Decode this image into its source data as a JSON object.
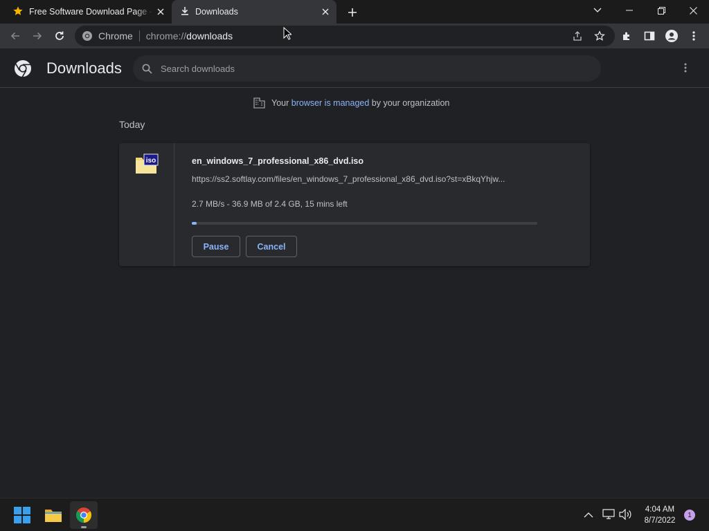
{
  "tabs": [
    {
      "title": "Free Software Download Page - S",
      "icon": "star-icon"
    },
    {
      "title": "Downloads",
      "icon": "download-icon"
    }
  ],
  "omnibox": {
    "site_chip": "Chrome",
    "url_scheme": "chrome://",
    "url_host": "downloads"
  },
  "header": {
    "title": "Downloads",
    "search_placeholder": "Search downloads"
  },
  "managed_notice": {
    "prefix": "Your",
    "link": "browser is managed",
    "suffix": "by your organization"
  },
  "section_label": "Today",
  "download": {
    "filename": "en_windows_7_professional_x86_dvd.iso",
    "url": "https://ss2.softlay.com/files/en_windows_7_professional_x86_dvd.iso?st=xBkqYhjw...",
    "status": "2.7 MB/s - 36.9 MB of 2.4 GB, 15 mins left",
    "progress_fraction": 0.015,
    "file_badge": "iso",
    "pause_label": "Pause",
    "cancel_label": "Cancel"
  },
  "taskbar": {
    "time": "4:04 AM",
    "date": "8/7/2022",
    "notification_count": "1"
  },
  "colors": {
    "accent": "#8ab4f8",
    "background": "#202124",
    "card": "#292a2d"
  }
}
